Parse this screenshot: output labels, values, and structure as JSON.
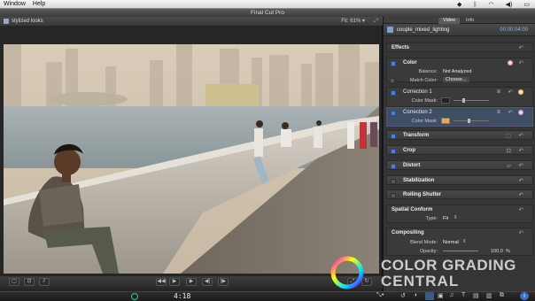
{
  "menubar": {
    "items": [
      "Window",
      "Help"
    ]
  },
  "app": {
    "title": "Final Cut Pro"
  },
  "viewer": {
    "project_name": "stylized looks",
    "fit_label": "Fit:",
    "fit_value": "61%"
  },
  "inspector": {
    "tabs": [
      "Video",
      "Info"
    ],
    "clip_name": "couple_mixed_lighting",
    "clip_timecode": "00:00:04:00",
    "effects_header": "Effects",
    "color": {
      "title": "Color",
      "balance_label": "Balance:",
      "balance_value": "Not Analyzed",
      "match_label": "Match Color:",
      "match_value": "Choose..."
    },
    "correction1": {
      "title": "Correction 1",
      "mask_label": "Color Mask:"
    },
    "correction2": {
      "title": "Correction 2",
      "mask_label": "Color Mask:"
    },
    "sections": [
      "Transform",
      "Crop",
      "Distort",
      "Stabilization",
      "Rolling Shutter"
    ],
    "spatial": {
      "title": "Spatial Conform",
      "type_label": "Type:",
      "type_value": "Fit"
    },
    "compositing": {
      "title": "Compositing",
      "blend_label": "Blend Mode:",
      "blend_value": "Normal",
      "opacity_label": "Opacity:",
      "opacity_value": "100.0",
      "opacity_unit": "%"
    }
  },
  "timeline": {
    "timecode": "4:18"
  },
  "watermark": {
    "line1": "COLOR GRADING",
    "line2": "CENTRAL"
  },
  "colors": {
    "accent_blue": "#4a7fd4",
    "mask_orange": "#e8a85a",
    "panel": "#353535"
  }
}
